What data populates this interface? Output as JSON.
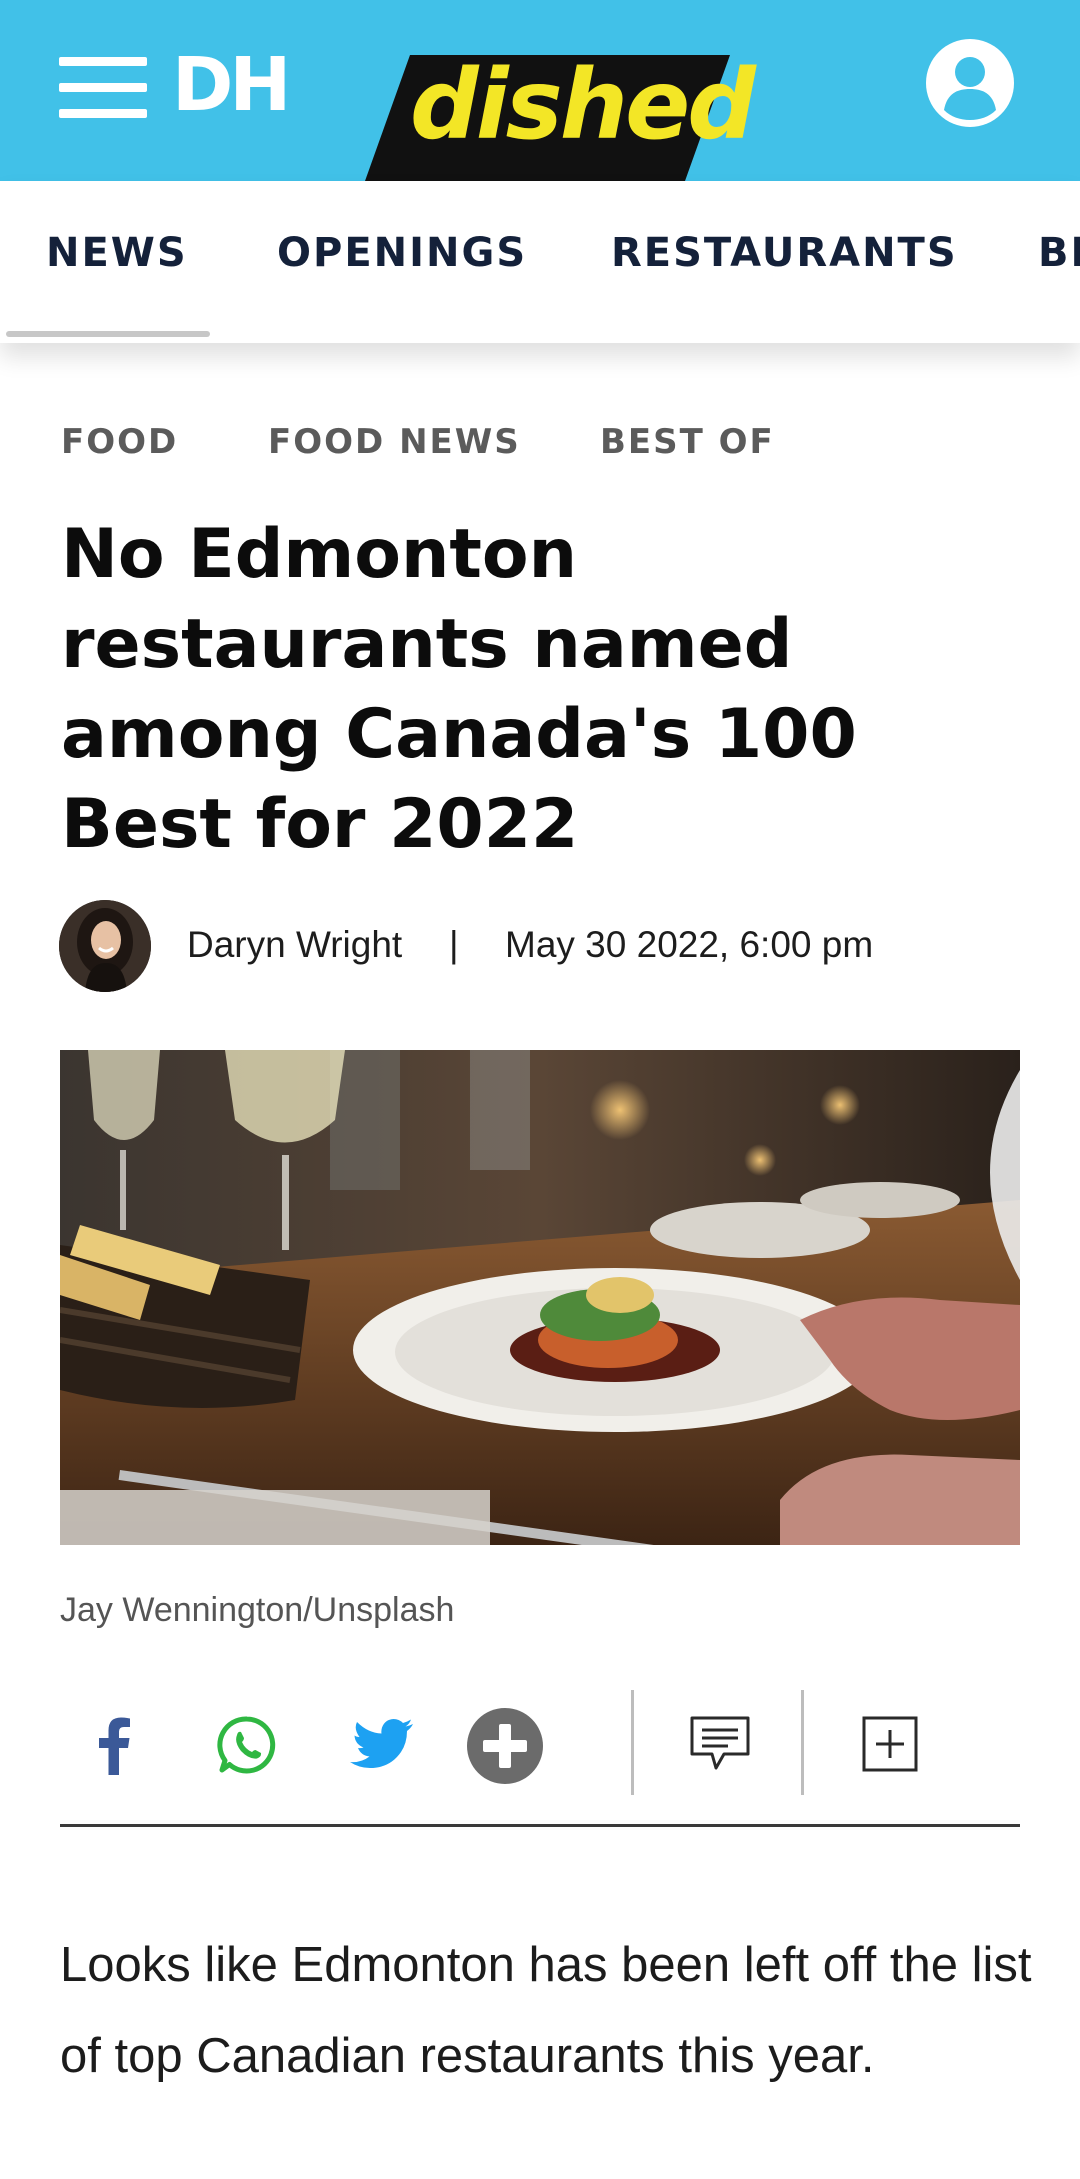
{
  "header": {
    "menu_icon": "hamburger-menu-icon",
    "site_logo": "DH",
    "section_logo": "dished",
    "account_icon": "user-account-icon",
    "brand_color": "#41c1e8",
    "logo_yellow": "#f3e626"
  },
  "nav": {
    "items": [
      {
        "label": "NEWS",
        "active": true
      },
      {
        "label": "OPENINGS"
      },
      {
        "label": "RESTAURANTS"
      },
      {
        "label": "BEST"
      }
    ]
  },
  "tags": [
    "FOOD",
    "FOOD NEWS",
    "BEST OF"
  ],
  "article": {
    "title": "No Edmonton restaurants named among Canada's 100 Best for 2022",
    "author": "Daryn Wright",
    "separator": "|",
    "date": "May 30 2022, 6:00 pm",
    "image_credit": "Jay Wennington/Unsplash",
    "intro": "Looks like Edmonton has been left off the list of top Canadian restaurants this year."
  },
  "share": {
    "buttons": [
      {
        "icon": "facebook-icon",
        "color": "#3b5998"
      },
      {
        "icon": "whatsapp-icon",
        "color": "#2fb742"
      },
      {
        "icon": "twitter-icon",
        "color": "#1da1f2"
      },
      {
        "icon": "more-share-icon",
        "color": "#6b6b6b"
      },
      {
        "icon": "comment-icon"
      },
      {
        "icon": "bookmark-add-icon"
      }
    ]
  }
}
